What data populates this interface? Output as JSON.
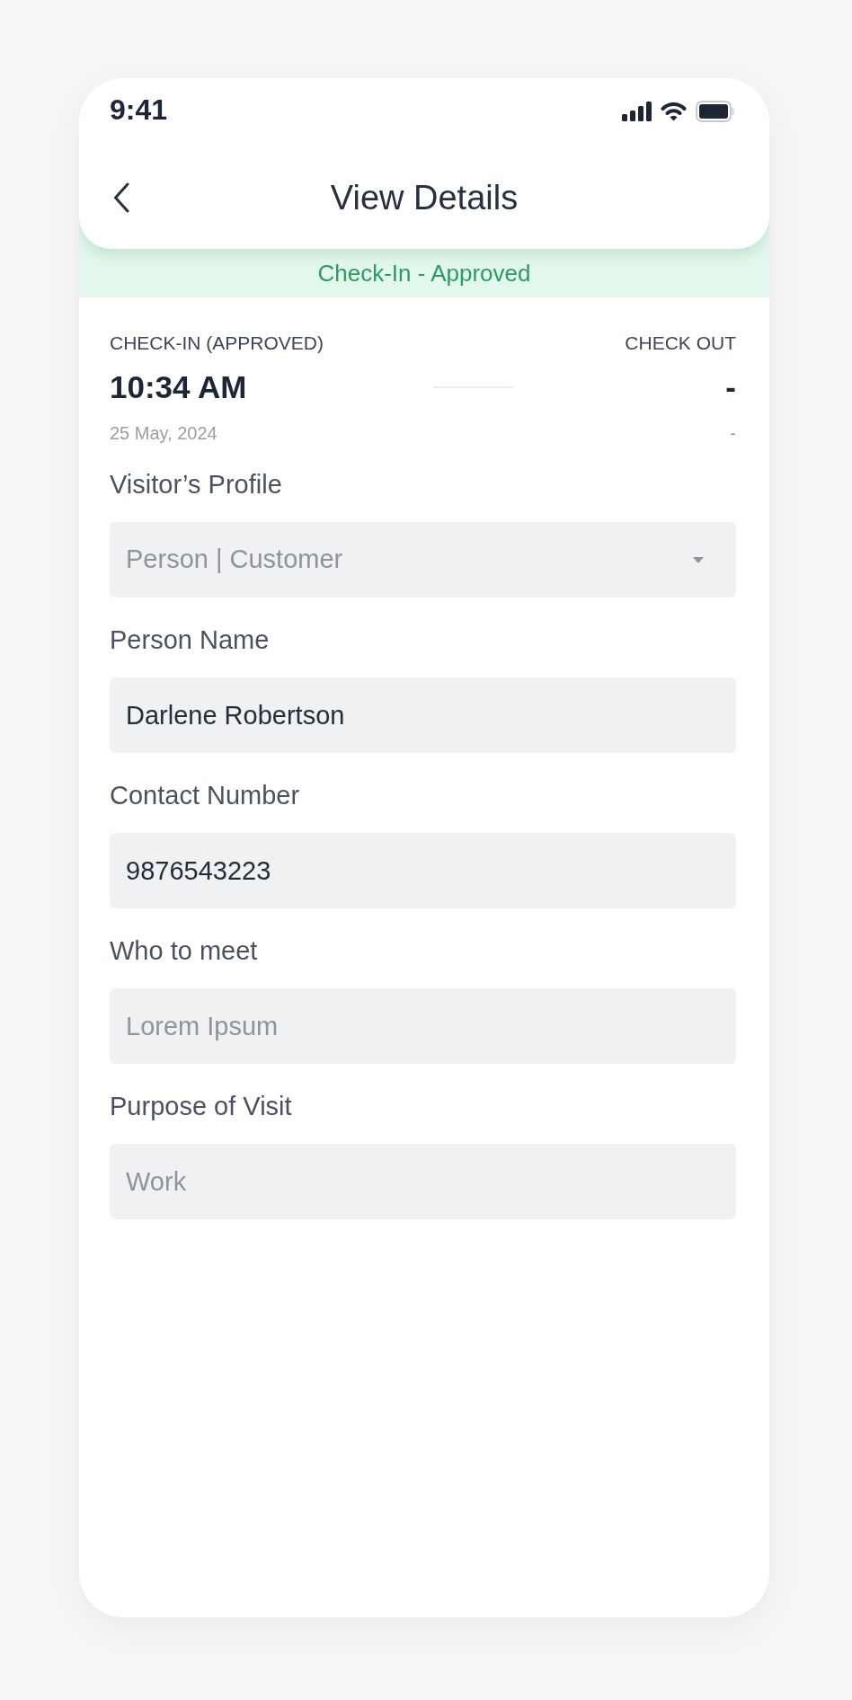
{
  "status_bar": {
    "time": "9:41"
  },
  "header": {
    "title": "View Details"
  },
  "banner": {
    "text": "Check-In - Approved"
  },
  "check_times": {
    "check_in": {
      "label": "CHECK-IN (APPROVED)",
      "time": "10:34 AM",
      "date": "25 May, 2024"
    },
    "check_out": {
      "label": "CHECK OUT",
      "time": "-",
      "date": "-"
    }
  },
  "fields": [
    {
      "kind": "select",
      "label": "Visitor’s Profile",
      "placeholder": "Person | Customer"
    },
    {
      "kind": "text",
      "label": "Person Name",
      "value": "Darlene Robertson"
    },
    {
      "kind": "text",
      "label": "Contact Number",
      "value": "9876543223"
    },
    {
      "kind": "text",
      "label": "Who to meet",
      "placeholder": "Lorem Ipsum"
    },
    {
      "kind": "text",
      "label": "Purpose of Visit",
      "placeholder": "Work"
    }
  ]
}
